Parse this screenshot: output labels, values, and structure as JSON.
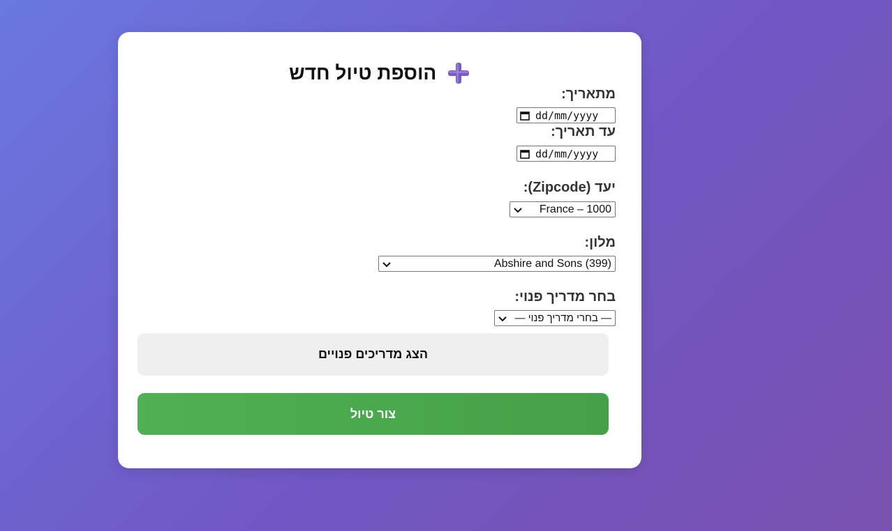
{
  "form": {
    "title": "הוספת טיול חדש",
    "title_icon": "plus-icon",
    "from_date_label": "מתאריך:",
    "from_date_value": "dd/mm/yyyy",
    "to_date_label": "עד תאריך:",
    "to_date_value": "dd/mm/yyyy",
    "destination_label": "יעד (Zipcode):",
    "destination_selected": "France – 1000",
    "hotel_label": "מלון:",
    "hotel_selected": "Abshire and Sons (399)",
    "guide_label": "בחר מדריך פנוי:",
    "guide_selected": "— בחרי מדריך פנוי —",
    "show_guides_button": "הצג מדריכים פנויים",
    "create_trip_button": "צור טיול"
  },
  "colors": {
    "background_start": "#6a78e0",
    "background_end": "#7a52b0",
    "primary_green": "#4caf50",
    "secondary_gray": "#efefef",
    "icon_purple": "#7b5cc4"
  }
}
